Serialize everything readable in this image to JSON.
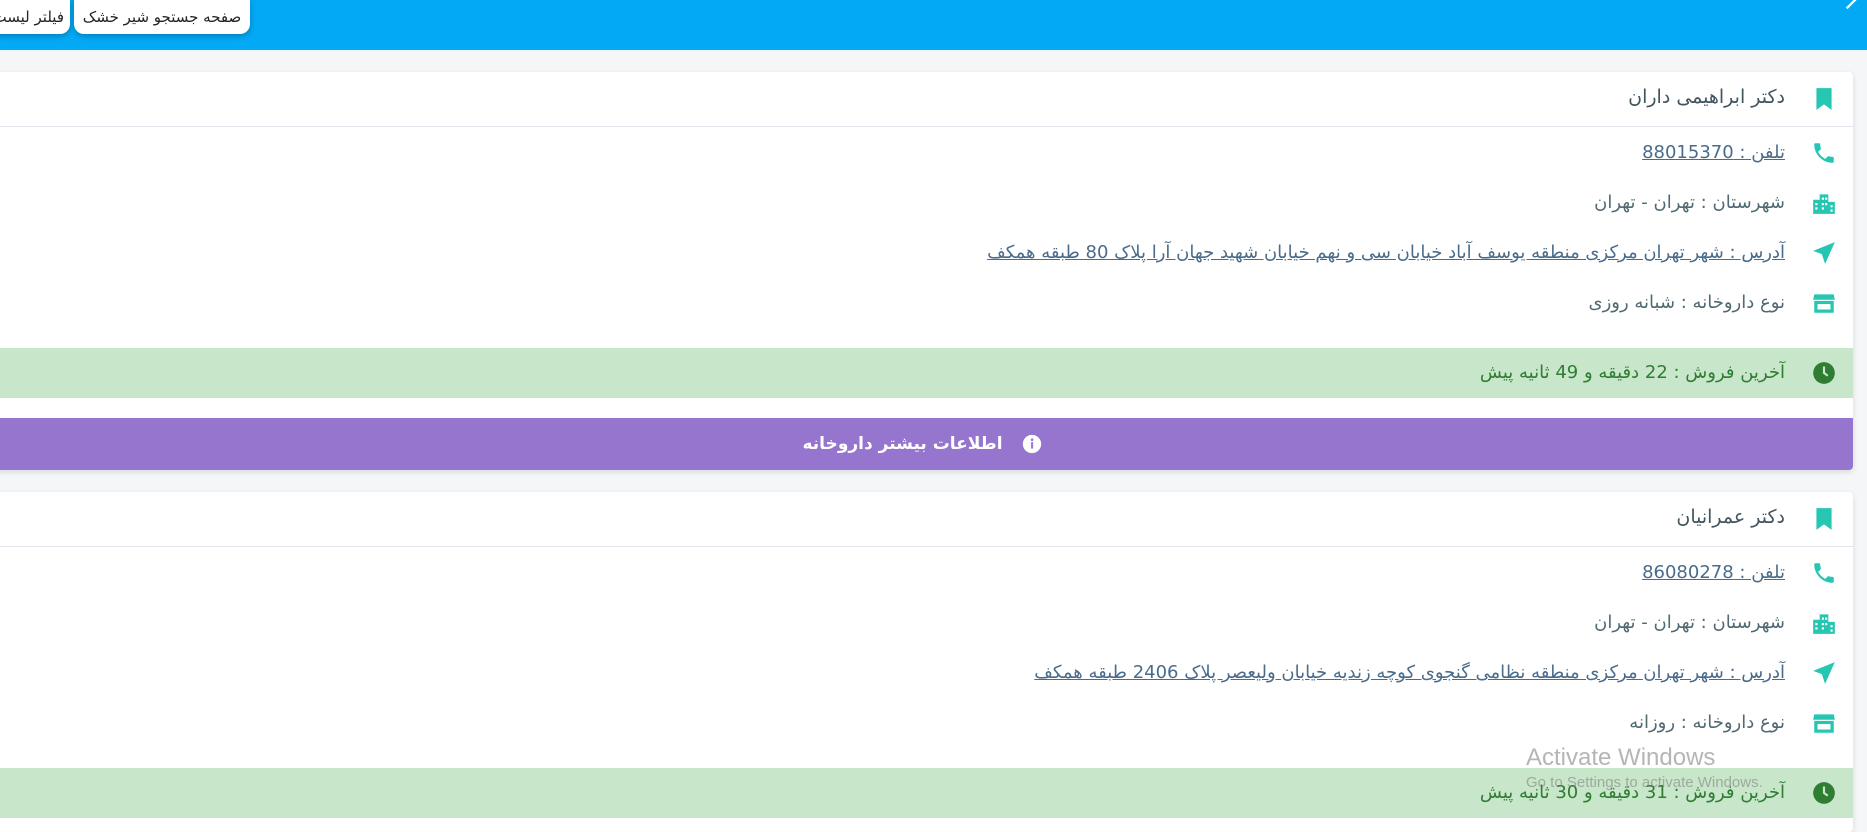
{
  "header": {
    "search_button_label": "صفحه جستجو شیر خشک",
    "filter_button_label": "فیلتر لیست"
  },
  "pharmacies": [
    {
      "name": "دکتر ابراهیمی داران",
      "phone": "تلفن : 88015370",
      "county": "شهرستان : تهران - تهران",
      "address": "آدرس : شهر تهران مرکزی منطقه یوسف آباد خیابان سی و نهم خیابان شهید جهان آرا پلاک 80 طبقه همکف",
      "type": "نوع داروخانه : شبانه روزی",
      "last_sale": "آخرین فروش : 22 دقیقه و 49 ثانیه پیش",
      "more_info_label": "اطلاعات بیشتر داروخانه"
    },
    {
      "name": "دکتر عمرانیان",
      "phone": "تلفن : 86080278",
      "county": "شهرستان : تهران - تهران",
      "address": "آدرس : شهر تهران مرکزی منطقه نظامی گنجوی کوچه زندیه خیابان ولیعصر پلاک 2406 طبقه همکف",
      "type": "نوع داروخانه : روزانه",
      "last_sale": "آخرین فروش : 31 دقیقه و 30 ثانیه پیش"
    }
  ],
  "watermark": {
    "line1": "Activate Windows",
    "line2": "Go to Settings to activate Windows."
  },
  "colors": {
    "header": "#03a9f4",
    "icon_teal": "#26c6b3",
    "last_sale_bg": "#c8e6c9",
    "last_sale_text": "#2e7d32",
    "more_button": "#9575cd"
  },
  "icons": [
    "bookmark-icon",
    "phone-icon",
    "city-icon",
    "send-icon",
    "store-icon",
    "clock-icon",
    "info-icon"
  ]
}
